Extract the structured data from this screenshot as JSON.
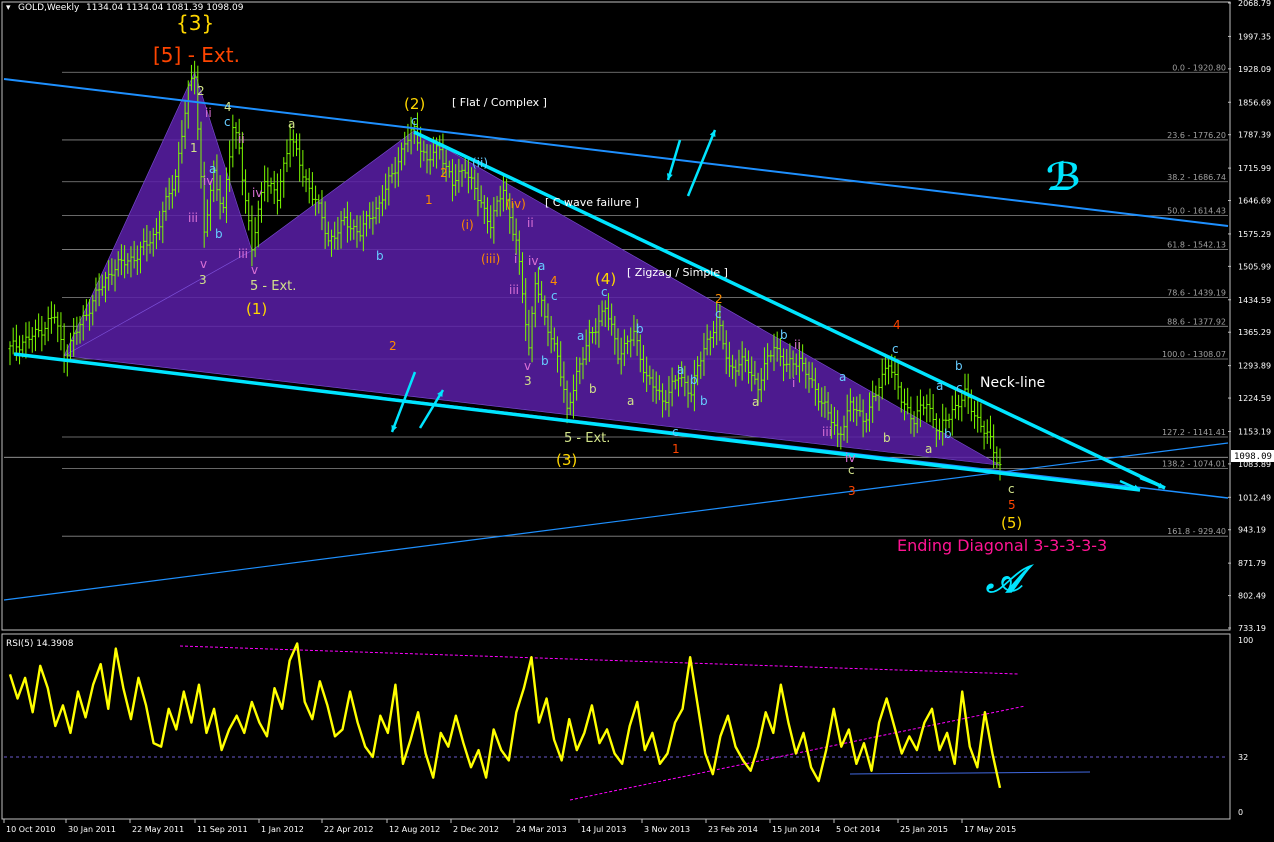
{
  "header": {
    "symbol": "GOLD,Weekly",
    "ohlc": "1134.04 1134.04 1081.39 1098.09"
  },
  "colors": {
    "background": "#000000",
    "bullish_bar": "#7CFC00",
    "price_axis_text": "#ffffff",
    "channel_line": "#00e5ff",
    "channel_thin_line": "#1e90ff",
    "pattern_fill": "#5a1fa8",
    "rsi_line": "#ffff00",
    "rsi_guide": "#ff00ff",
    "fib_line": "#8a8a8a",
    "wave_yellow": "#ffd700",
    "wave_orange": "#ff8c00",
    "wave_magenta": "#da70d6",
    "wave_cyan": "#66ccff",
    "wave_red": "#ff4500",
    "ending_diagonal": "#ff1493"
  },
  "chart_data": [
    {
      "type": "line",
      "panel": "price",
      "symbol": "GOLD",
      "timeframe": "Weekly",
      "y_range": [
        733.19,
        2068.79
      ],
      "current_price": "1098.09",
      "x_tick_labels": [
        "10 Oct 2010",
        "30 Jan 2011",
        "22 May 2011",
        "11 Sep 2011",
        "1 Jan 2012",
        "22 Apr 2012",
        "12 Aug 2012",
        "2 Dec 2012",
        "24 Mar 2013",
        "14 Jul 2013",
        "3 Nov 2013",
        "23 Feb 2014",
        "15 Jun 2014",
        "5 Oct 2014",
        "25 Jan 2015",
        "17 May 2015"
      ],
      "y_tick_labels": [
        "2068.79",
        "1997.35",
        "1928.09",
        "1856.69",
        "1787.39",
        "1715.99",
        "1646.69",
        "1575.29",
        "1505.99",
        "1434.59",
        "1365.29",
        "1293.89",
        "1224.59",
        "1153.19",
        "1083.89",
        "1012.49",
        "943.19",
        "871.79",
        "802.49",
        "733.19"
      ],
      "price_path": [
        {
          "t": 0,
          "p": 1330
        },
        {
          "t": 8,
          "p": 1360
        },
        {
          "t": 14,
          "p": 1400
        },
        {
          "t": 17,
          "p": 1315
        },
        {
          "t": 25,
          "p": 1420
        },
        {
          "t": 32,
          "p": 1500
        },
        {
          "t": 40,
          "p": 1530
        },
        {
          "t": 46,
          "p": 1580
        },
        {
          "t": 52,
          "p": 1700
        },
        {
          "t": 56,
          "p": 1880
        },
        {
          "t": 58,
          "p": 1921
        },
        {
          "t": 61,
          "p": 1580
        },
        {
          "t": 64,
          "p": 1700
        },
        {
          "t": 67,
          "p": 1630
        },
        {
          "t": 70,
          "p": 1800
        },
        {
          "t": 72,
          "p": 1760
        },
        {
          "t": 76,
          "p": 1540
        },
        {
          "t": 80,
          "p": 1700
        },
        {
          "t": 84,
          "p": 1650
        },
        {
          "t": 88,
          "p": 1790
        },
        {
          "t": 92,
          "p": 1700
        },
        {
          "t": 96,
          "p": 1650
        },
        {
          "t": 100,
          "p": 1560
        },
        {
          "t": 105,
          "p": 1600
        },
        {
          "t": 110,
          "p": 1580
        },
        {
          "t": 116,
          "p": 1640
        },
        {
          "t": 120,
          "p": 1700
        },
        {
          "t": 124,
          "p": 1770
        },
        {
          "t": 127,
          "p": 1796
        },
        {
          "t": 131,
          "p": 1730
        },
        {
          "t": 135,
          "p": 1760
        },
        {
          "t": 139,
          "p": 1680
        },
        {
          "t": 143,
          "p": 1720
        },
        {
          "t": 147,
          "p": 1650
        },
        {
          "t": 151,
          "p": 1600
        },
        {
          "t": 155,
          "p": 1670
        },
        {
          "t": 159,
          "p": 1560
        },
        {
          "t": 163,
          "p": 1330
        },
        {
          "t": 165,
          "p": 1480
        },
        {
          "t": 168,
          "p": 1390
        },
        {
          "t": 172,
          "p": 1320
        },
        {
          "t": 175,
          "p": 1190
        },
        {
          "t": 178,
          "p": 1280
        },
        {
          "t": 182,
          "p": 1350
        },
        {
          "t": 187,
          "p": 1420
        },
        {
          "t": 191,
          "p": 1320
        },
        {
          "t": 196,
          "p": 1360
        },
        {
          "t": 200,
          "p": 1270
        },
        {
          "t": 205,
          "p": 1220
        },
        {
          "t": 210,
          "p": 1270
        },
        {
          "t": 214,
          "p": 1240
        },
        {
          "t": 218,
          "p": 1330
        },
        {
          "t": 222,
          "p": 1392
        },
        {
          "t": 226,
          "p": 1290
        },
        {
          "t": 231,
          "p": 1300
        },
        {
          "t": 235,
          "p": 1250
        },
        {
          "t": 240,
          "p": 1340
        },
        {
          "t": 244,
          "p": 1290
        },
        {
          "t": 248,
          "p": 1310
        },
        {
          "t": 252,
          "p": 1250
        },
        {
          "t": 256,
          "p": 1210
        },
        {
          "t": 260,
          "p": 1140
        },
        {
          "t": 264,
          "p": 1210
        },
        {
          "t": 268,
          "p": 1180
        },
        {
          "t": 272,
          "p": 1230
        },
        {
          "t": 276,
          "p": 1307
        },
        {
          "t": 280,
          "p": 1220
        },
        {
          "t": 284,
          "p": 1180
        },
        {
          "t": 288,
          "p": 1215
        },
        {
          "t": 292,
          "p": 1150
        },
        {
          "t": 296,
          "p": 1200
        },
        {
          "t": 300,
          "p": 1230
        },
        {
          "t": 304,
          "p": 1180
        },
        {
          "t": 308,
          "p": 1130
        },
        {
          "t": 311,
          "p": 1081
        }
      ],
      "fibonacci_levels": [
        {
          "label": "0.0 - 1920.80",
          "price": 1920.8
        },
        {
          "label": "23.6 - 1776.20",
          "price": 1776.2
        },
        {
          "label": "38.2 - 1686.74",
          "price": 1686.74
        },
        {
          "label": "50.0 - 1614.43",
          "price": 1614.43
        },
        {
          "label": "61.8 - 1542.13",
          "price": 1542.13
        },
        {
          "label": "78.6 - 1439.19",
          "price": 1439.19
        },
        {
          "label": "88.6 - 1377.92",
          "price": 1377.92
        },
        {
          "label": "100.0 - 1308.07",
          "price": 1308.07
        },
        {
          "label": "127.2 - 1141.41",
          "price": 1141.41
        },
        {
          "label": "138.2 - 1074.01",
          "price": 1074.01
        },
        {
          "label": "161.8 - 929.40",
          "price": 929.4
        }
      ],
      "annotations": {
        "degree_3": "{3}",
        "wave_5_ext_top": "[5] - Ext.",
        "wave_1_major": "(1)",
        "wave_2_major": "(2)",
        "wave_3_major": "(3)",
        "wave_4_major": "(4)",
        "wave_5_major": "(5)",
        "flat_complex": "[ Flat / Complex ]",
        "c_wave_failure": "[ C wave failure ]",
        "zigzag_simple": "[ Zigzag / Simple ]",
        "five_ext_1": "5 - Ext.",
        "five_ext_2": "5 - Ext.",
        "neck_line": "Neck-line",
        "ending_diagonal": "Ending Diagonal 3-3-3-3-3",
        "script_b": "ℬ",
        "script_a": "𝒜"
      }
    },
    {
      "type": "line",
      "panel": "rsi",
      "title": "RSI(5) 14.3908",
      "y_range": [
        0,
        100
      ],
      "y_tick_labels": [
        "100",
        "32",
        "0"
      ],
      "levels": [
        32
      ],
      "values": [
        80,
        66,
        78,
        58,
        85,
        72,
        50,
        62,
        46,
        70,
        55,
        74,
        86,
        60,
        95,
        72,
        54,
        78,
        62,
        40,
        38,
        60,
        48,
        70,
        52,
        74,
        46,
        60,
        36,
        48,
        56,
        46,
        64,
        52,
        44,
        72,
        60,
        88,
        98,
        64,
        54,
        76,
        62,
        44,
        48,
        70,
        52,
        38,
        32,
        56,
        46,
        74,
        28,
        42,
        58,
        34,
        20,
        46,
        38,
        56,
        40,
        26,
        36,
        20,
        48,
        36,
        30,
        58,
        72,
        90,
        52,
        66,
        42,
        30,
        54,
        36,
        46,
        62,
        40,
        48,
        34,
        28,
        50,
        64,
        36,
        46,
        28,
        34,
        52,
        60,
        90,
        62,
        34,
        22,
        44,
        56,
        38,
        30,
        24,
        38,
        58,
        46,
        74,
        52,
        34,
        46,
        26,
        18,
        36,
        60,
        38,
        48,
        28,
        40,
        24,
        52,
        66,
        50,
        34,
        44,
        36,
        52,
        60,
        36,
        46,
        28,
        70,
        38,
        26,
        58,
        34,
        14
      ]
    }
  ]
}
